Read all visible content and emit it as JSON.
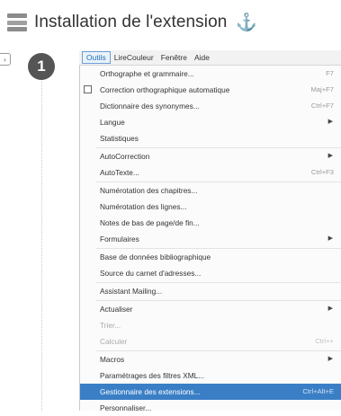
{
  "header": {
    "title": "Installation de l'extension",
    "title_icon": "menu-bars-icon",
    "trailing_glyph": "⚓"
  },
  "step": {
    "number": "1"
  },
  "menubar": {
    "items": [
      "Outils",
      "LireCouleur",
      "Fenêtre",
      "Aide"
    ],
    "active_index": 0
  },
  "menu": {
    "items": [
      {
        "label": "Orthographe et grammaire...",
        "accel": "F7"
      },
      {
        "label": "Correction orthographique automatique",
        "accel": "Maj+F7",
        "checkbox": true
      },
      {
        "label": "Dictionnaire des synonymes...",
        "accel": "Ctrl+F7"
      },
      {
        "label": "Langue",
        "submenu": true
      },
      {
        "label": "Statistiques"
      },
      {
        "label": "AutoCorrection",
        "submenu": true
      },
      {
        "label": "AutoTexte...",
        "accel": "Ctrl+F3"
      },
      {
        "label": "Numérotation des chapitres..."
      },
      {
        "label": "Numérotation des lignes..."
      },
      {
        "label": "Notes de bas de page/de fin..."
      },
      {
        "label": "Formulaires",
        "submenu": true
      },
      {
        "label": "Base de données bibliographique"
      },
      {
        "label": "Source du carnet d'adresses..."
      },
      {
        "label": "Assistant Mailing..."
      },
      {
        "label": "Actualiser",
        "submenu": true
      },
      {
        "label": "Trier...",
        "disabled": true
      },
      {
        "label": "Calculer",
        "accel": "Ctrl++",
        "disabled": true
      },
      {
        "label": "Macros",
        "submenu": true
      },
      {
        "label": "Paramétrages des filtres XML..."
      },
      {
        "label": "Gestionnaire des extensions...",
        "accel": "Ctrl+Alt+E",
        "highlighted": true
      },
      {
        "label": "Personnaliser..."
      }
    ]
  },
  "colors": {
    "highlight": "#3a7fc6",
    "active_menu_text": "#1f6fb8",
    "step_badge": "#555555"
  }
}
